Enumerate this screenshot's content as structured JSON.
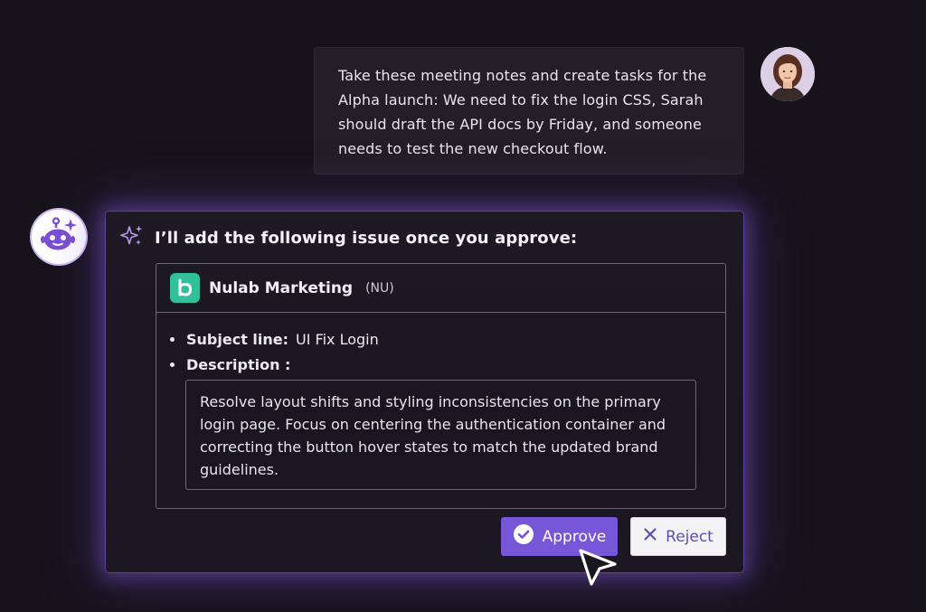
{
  "user_message": {
    "text": "Take these meeting notes and create tasks for the Alpha launch: We need to fix the login CSS, Sarah should draft the API docs by Friday, and someone needs to test the new checkout flow."
  },
  "bot_card": {
    "heading": "I’ll add the following issue once you approve:",
    "project": {
      "name": "Nulab Marketing",
      "key": "(NU)"
    },
    "fields": {
      "subject_label": "Subject line:",
      "subject_value": "UI Fix Login",
      "description_label": "Description :",
      "description_value": "Resolve layout shifts and styling inconsistencies on the primary login page. Focus on centering the authentication container and correcting the button hover states to match the updated brand guidelines."
    },
    "actions": {
      "approve_label": "Approve",
      "reject_label": "Reject"
    }
  },
  "colors": {
    "background": "#16131a",
    "accent": "#7856d8",
    "project_logo": "#32c09a",
    "glow": "#825adc"
  },
  "icons": [
    "user-avatar",
    "bot-avatar",
    "sparkle-icon",
    "project-logo-icon",
    "check-circle-icon",
    "close-icon",
    "mouse-cursor-icon"
  ]
}
